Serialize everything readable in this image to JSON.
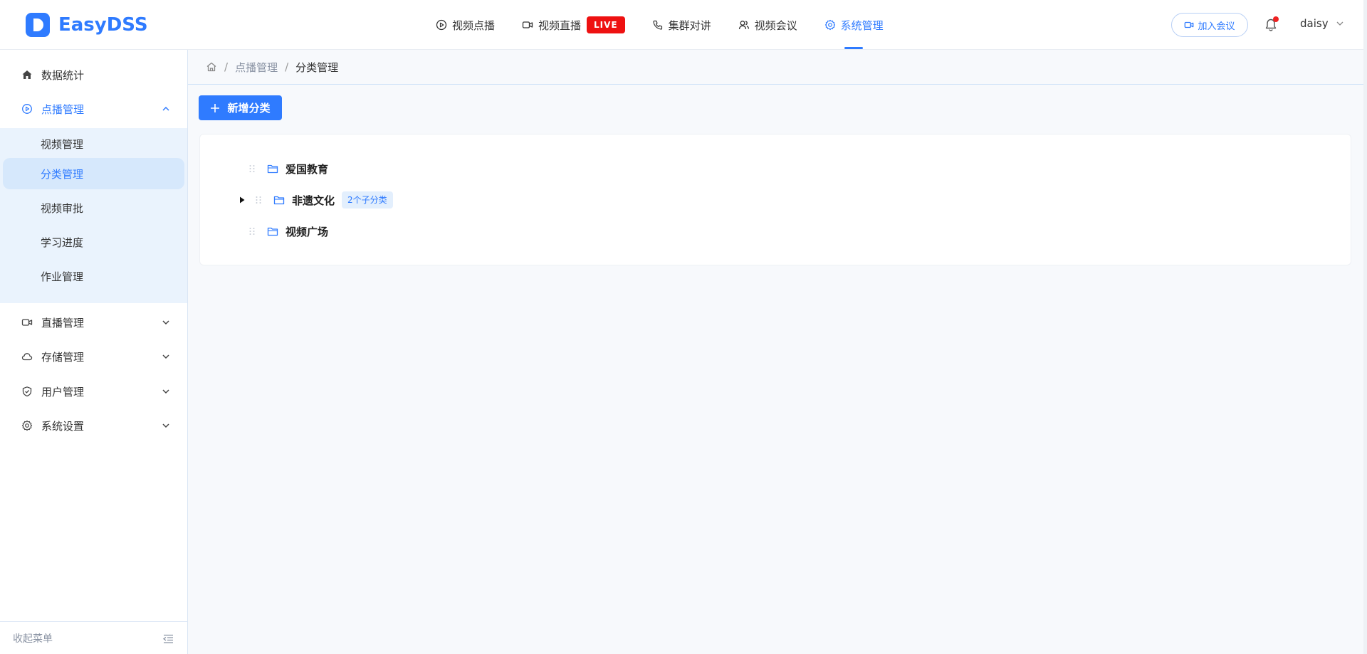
{
  "brand": {
    "name": "EasyDSS",
    "color": "#2f7bff"
  },
  "topnav": {
    "items": [
      {
        "label": "视频点播",
        "icon": "play-circle-icon"
      },
      {
        "label": "视频直播",
        "icon": "video-camera-icon",
        "badge": "LIVE"
      },
      {
        "label": "集群对讲",
        "icon": "phone-icon"
      },
      {
        "label": "视频会议",
        "icon": "users-icon"
      },
      {
        "label": "系统管理",
        "icon": "gear-icon",
        "active": true
      }
    ],
    "join_meeting": "加入会议",
    "user": "daisy"
  },
  "sidebar": {
    "items": [
      {
        "label": "数据统计",
        "icon": "home-icon"
      },
      {
        "label": "点播管理",
        "icon": "play-circle-icon",
        "expanded": true
      },
      {
        "label": "直播管理",
        "icon": "video-camera-icon"
      },
      {
        "label": "存储管理",
        "icon": "cloud-icon"
      },
      {
        "label": "用户管理",
        "icon": "shield-icon"
      },
      {
        "label": "系统设置",
        "icon": "gear-icon"
      }
    ],
    "submenu": [
      {
        "label": "视频管理"
      },
      {
        "label": "分类管理",
        "active": true
      },
      {
        "label": "视频审批"
      },
      {
        "label": "学习进度"
      },
      {
        "label": "作业管理"
      }
    ],
    "collapse_label": "收起菜单"
  },
  "breadcrumb": {
    "items": [
      "点播管理",
      "分类管理"
    ],
    "separator": "/"
  },
  "toolbar": {
    "add_label": "新增分类"
  },
  "tree": {
    "nodes": [
      {
        "label": "爱国教育"
      },
      {
        "label": "非遗文化",
        "badge": "2个子分类",
        "expandable": true
      },
      {
        "label": "视频广场"
      }
    ]
  },
  "colors": {
    "accent": "#2f7bff",
    "live": "#ee1111",
    "notify_dot": "#ee2222",
    "submenu_bg": "#eaf3fd"
  }
}
